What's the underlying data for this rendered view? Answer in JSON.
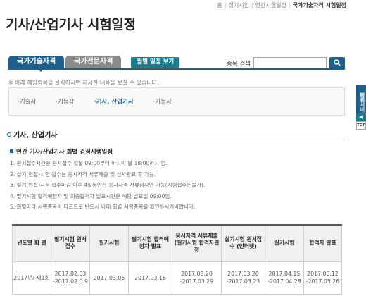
{
  "topnav": {
    "items": [
      "홈",
      "정기시험",
      "연간시험일정",
      "국가기술자격 시험일정"
    ]
  },
  "page": {
    "title": "기사/산업기사 시험일정"
  },
  "tabs": [
    {
      "label": "국가기술자격"
    },
    {
      "label": "국가전문자격"
    }
  ],
  "month_button": "월별 일정 보기",
  "search": {
    "label": "종목 검색",
    "value": "",
    "icon": "search-icon"
  },
  "hint": "※ 아래 해당항목을 클릭하시면 자세한 내용을 보실 수 있습니다.",
  "categories": [
    {
      "label": "·기술사"
    },
    {
      "label": "·기능장"
    },
    {
      "label": "·기사, 산업기사"
    },
    {
      "label": "·기능사"
    }
  ],
  "section": {
    "title": "기사, 산업기사",
    "subtitle": "연간 기사/산업기사 회별 검정시행일정",
    "notes": [
      "1. 원서접수시간은 원서접수 첫날 09:00부터 마지막 날 18:00까지 임.",
      "2. 실기(면접)시험 접수는 응시자격 서류제출 및 심사완료 후 가능.",
      "3. 실기(면접)시험 접수마감 이후 4일동안은 응시자격 서류심사만 가능(시험접수는불가).",
      "4. 필기시험 합격예정자 및 최종합격자 발표시간은 해당 발표일 09:00임.",
      "5. 회별마다 시행종목이 다르므로 반드시 아래 회별 시행종목을 확인하시기바랍니다."
    ]
  },
  "table": {
    "headers": [
      "년도별 회 별",
      "필기시험 원서접수",
      "필기시험",
      "필기시험 합격예정자 발표",
      "응시자격 서류제출(필기시험 합격자결정",
      "실기시험 원서접수 (인터넷)",
      "실기시험",
      "합격자 발표"
    ],
    "rows": [
      {
        "cells": [
          "2017년/ 제1회",
          "2017.02.03 -2017.02.0 9",
          "2017.03.05",
          "2017.03.16",
          "2017.03.20 -2017.03.29",
          "2017.03.20 -2017.03.23",
          "2017.04.15 -2017.04.28",
          "2017.05.12 -2017.05.26"
        ]
      }
    ]
  },
  "side": {
    "quick": "빠른서비스",
    "arrow": "◀",
    "top": "TOP"
  },
  "colors": {
    "primary": "#1f5f8b",
    "accent": "#1d7b8f",
    "inactive_tab": "#8a8a8a"
  }
}
